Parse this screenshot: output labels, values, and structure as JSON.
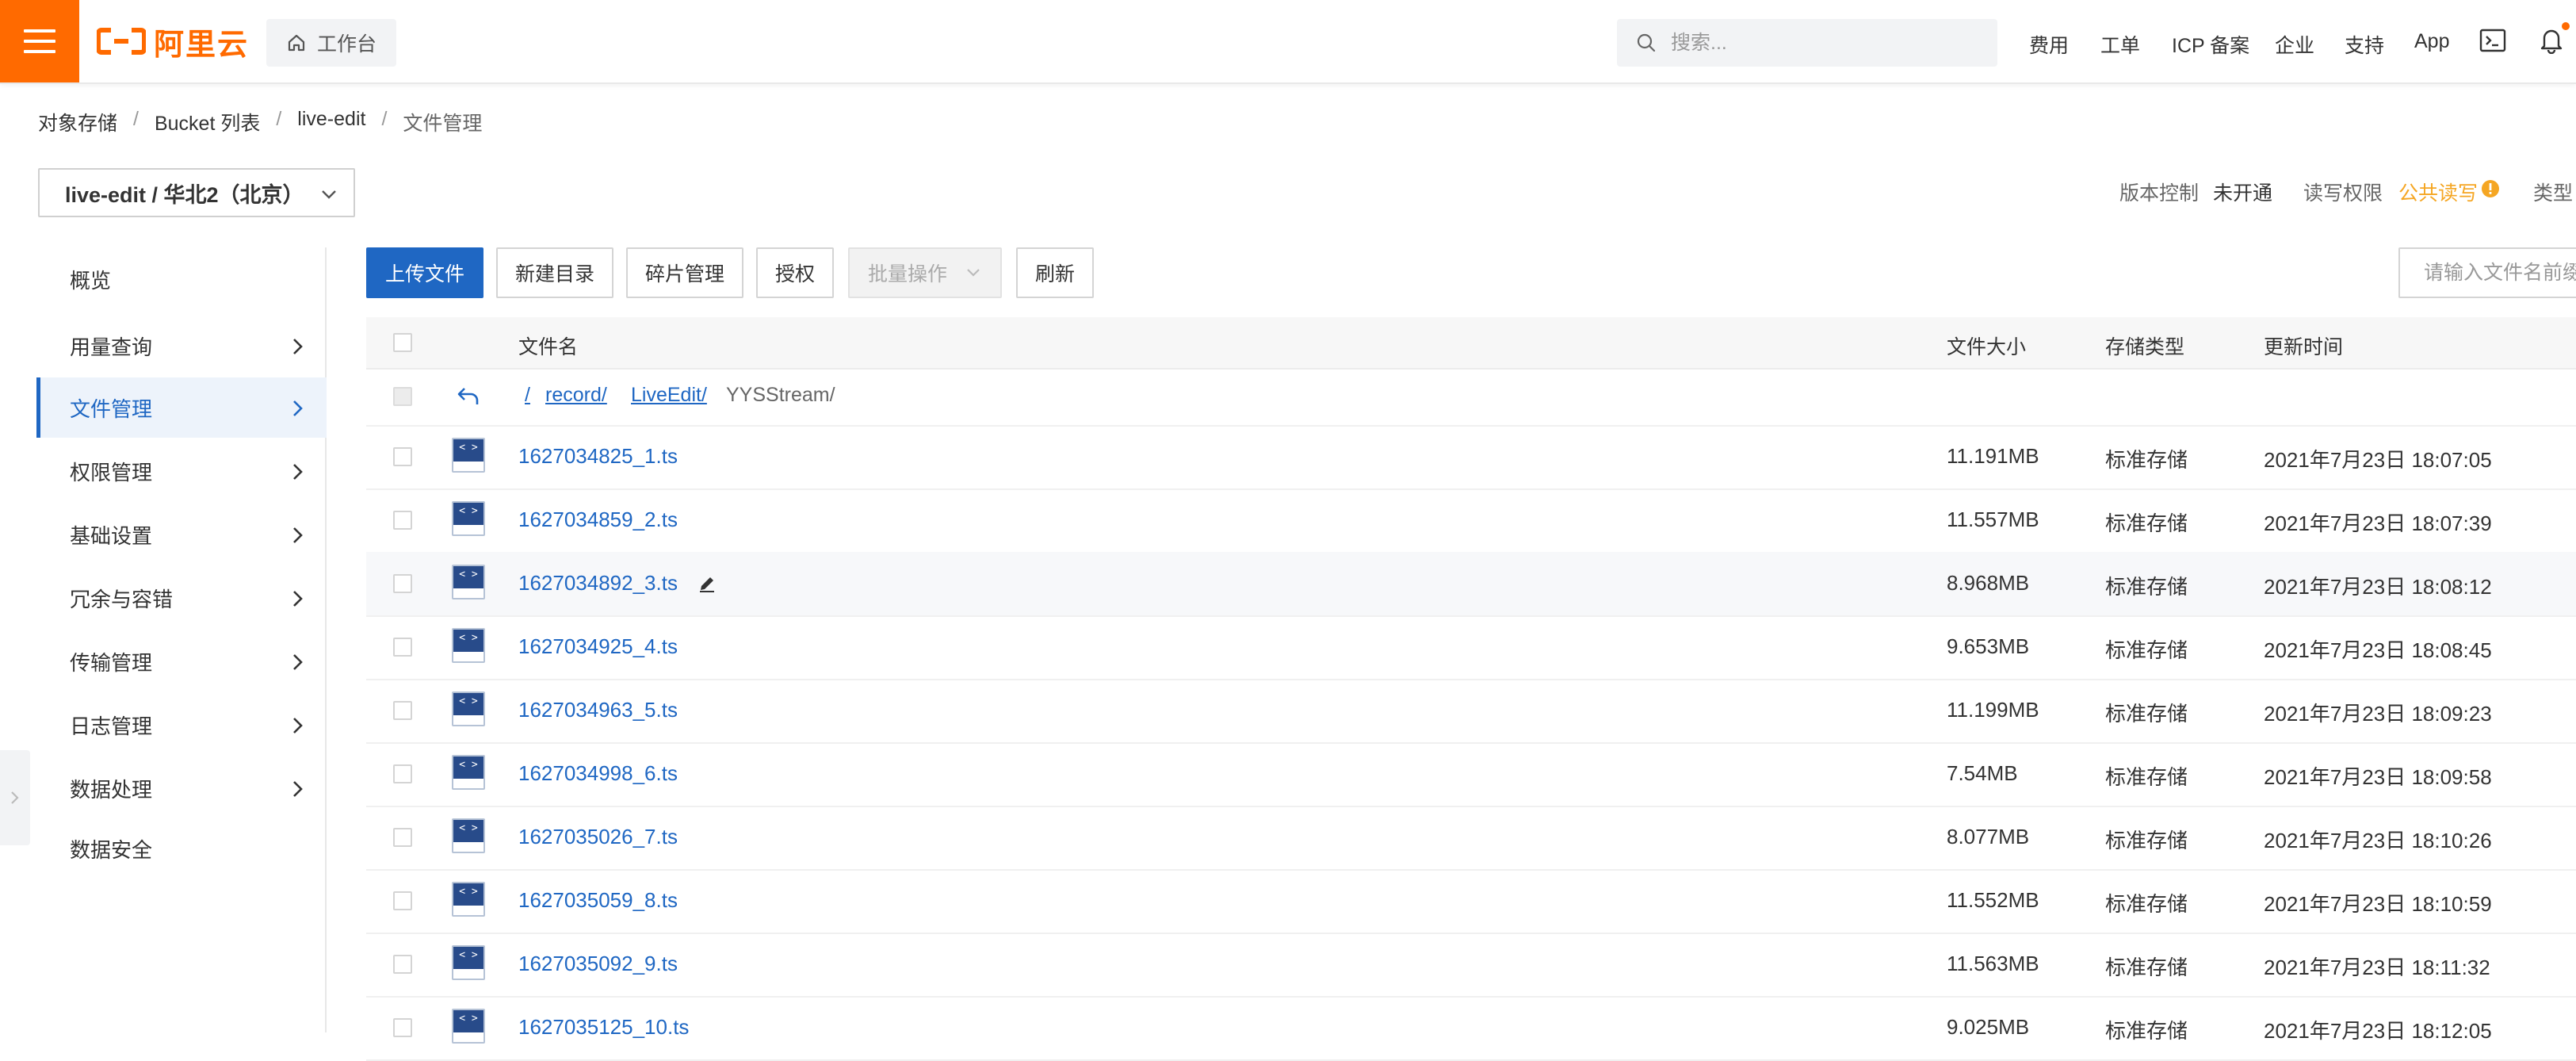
{
  "topbar": {
    "logo_text": "阿里云",
    "workbench_label": "工作台",
    "search_placeholder": "搜索...",
    "nav": [
      "费用",
      "工单",
      "ICP 备案",
      "企业",
      "支持",
      "App"
    ]
  },
  "breadcrumb": [
    "对象存储",
    "Bucket 列表",
    "live-edit",
    "文件管理"
  ],
  "bucket": {
    "selector_label": "live-edit / 华北2（北京）",
    "version_label": "版本控制",
    "version_value": "未开通",
    "acl_label": "读写权限",
    "acl_value": "公共读写",
    "type_label": "类型"
  },
  "sidebar": {
    "items": [
      {
        "label": "概览",
        "has_chevron": false,
        "active": false
      },
      {
        "label": "用量查询",
        "has_chevron": true,
        "active": false
      },
      {
        "label": "文件管理",
        "has_chevron": true,
        "active": true
      },
      {
        "label": "权限管理",
        "has_chevron": true,
        "active": false
      },
      {
        "label": "基础设置",
        "has_chevron": true,
        "active": false
      },
      {
        "label": "冗余与容错",
        "has_chevron": true,
        "active": false
      },
      {
        "label": "传输管理",
        "has_chevron": true,
        "active": false
      },
      {
        "label": "日志管理",
        "has_chevron": true,
        "active": false
      },
      {
        "label": "数据处理",
        "has_chevron": true,
        "active": false
      },
      {
        "label": "数据安全",
        "has_chevron": false,
        "active": false
      }
    ]
  },
  "toolbar": {
    "upload": "上传文件",
    "new_dir": "新建目录",
    "fragments": "碎片管理",
    "authorize": "授权",
    "batch": "批量操作",
    "refresh": "刷新",
    "filter_placeholder": "请输入文件名前缀"
  },
  "table": {
    "columns": {
      "name": "文件名",
      "size": "文件大小",
      "storage": "存储类型",
      "updated": "更新时间"
    },
    "path": {
      "root": "/",
      "segments": [
        "record/",
        "LiveEdit/"
      ],
      "current": "YYSStream/"
    },
    "icon_glyph": "< >",
    "rows": [
      {
        "name": "1627034825_1.ts",
        "size": "11.191MB",
        "storage": "标准存储",
        "updated": "2021年7月23日 18:07:05"
      },
      {
        "name": "1627034859_2.ts",
        "size": "11.557MB",
        "storage": "标准存储",
        "updated": "2021年7月23日 18:07:39"
      },
      {
        "name": "1627034892_3.ts",
        "size": "8.968MB",
        "storage": "标准存储",
        "updated": "2021年7月23日 18:08:12"
      },
      {
        "name": "1627034925_4.ts",
        "size": "9.653MB",
        "storage": "标准存储",
        "updated": "2021年7月23日 18:08:45"
      },
      {
        "name": "1627034963_5.ts",
        "size": "11.199MB",
        "storage": "标准存储",
        "updated": "2021年7月23日 18:09:23"
      },
      {
        "name": "1627034998_6.ts",
        "size": "7.54MB",
        "storage": "标准存储",
        "updated": "2021年7月23日 18:09:58"
      },
      {
        "name": "1627035026_7.ts",
        "size": "8.077MB",
        "storage": "标准存储",
        "updated": "2021年7月23日 18:10:26"
      },
      {
        "name": "1627035059_8.ts",
        "size": "11.552MB",
        "storage": "标准存储",
        "updated": "2021年7月23日 18:10:59"
      },
      {
        "name": "1627035092_9.ts",
        "size": "11.563MB",
        "storage": "标准存储",
        "updated": "2021年7月23日 18:11:32"
      },
      {
        "name": "1627035125_10.ts",
        "size": "9.025MB",
        "storage": "标准存储",
        "updated": "2021年7月23日 18:12:05"
      }
    ]
  },
  "colors": {
    "brand_orange": "#ff6a00",
    "primary_blue": "#1f67c3",
    "acl_warning": "#f5a623"
  }
}
